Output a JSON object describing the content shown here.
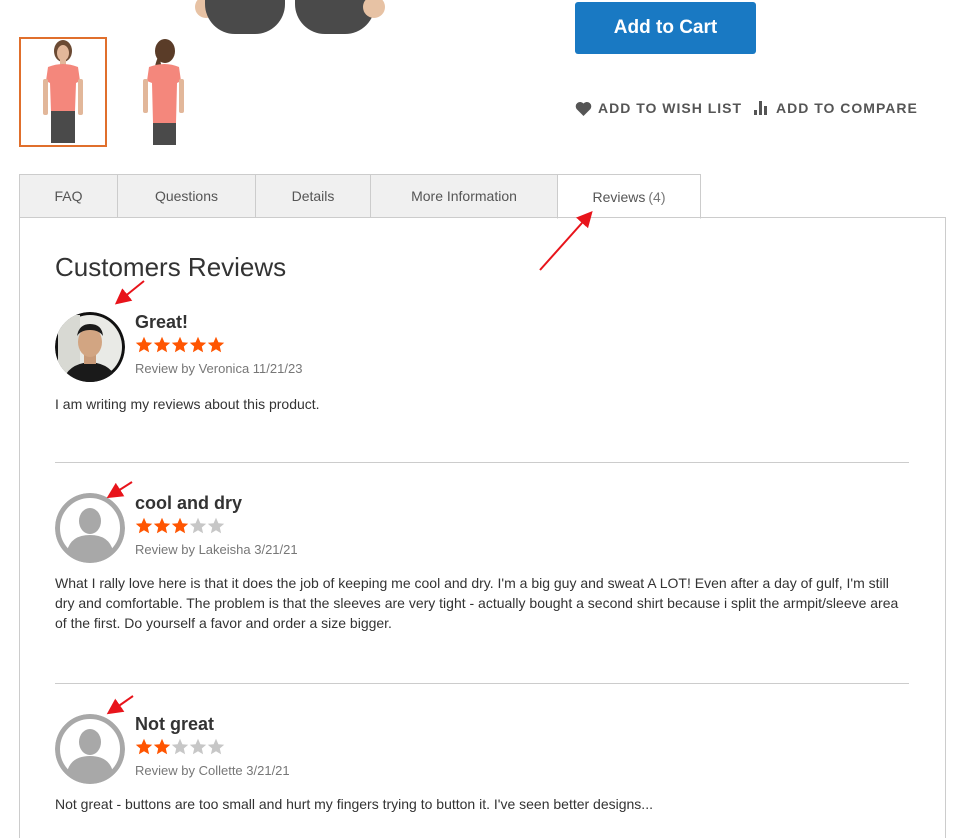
{
  "product": {
    "add_to_cart_label": "Add to Cart",
    "wishlist_label": "ADD TO WISH LIST",
    "compare_label": "ADD TO COMPARE"
  },
  "tabs": [
    {
      "label": "FAQ"
    },
    {
      "label": "Questions"
    },
    {
      "label": "Details"
    },
    {
      "label": "More Information"
    },
    {
      "label": "Reviews",
      "count": "(4)",
      "active": true
    }
  ],
  "reviews_section": {
    "heading": "Customers Reviews",
    "reviews": [
      {
        "title": "Great!",
        "rating": 5,
        "byline": "Review by Veronica 11/21/23",
        "text": "I am writing my reviews about this product.",
        "avatar": "photo"
      },
      {
        "title": "cool and dry",
        "rating": 3,
        "byline": "Review by Lakeisha 3/21/21",
        "text": "What I rally love here is that it does the job of keeping me cool and dry. I'm a big guy and sweat A LOT! Even after a day of gulf, I'm still dry and comfortable. The problem is that the sleeves are very tight - actually bought a second shirt because i split the armpit/sleeve area of the first. Do yourself a favor and order a size bigger.",
        "avatar": "placeholder"
      },
      {
        "title": "Not great",
        "rating": 2,
        "byline": "Review by Collette 3/21/21",
        "text": "Not great - buttons are too small and hurt my fingers trying to button it. I've seen better designs...",
        "avatar": "placeholder"
      }
    ]
  },
  "colors": {
    "accent_blue": "#1979c3",
    "star_filled": "#ff5501",
    "star_empty": "#c7c7c7",
    "thumb_active_border": "#e06f2c",
    "annotation_red": "#e8141b"
  },
  "icons": [
    "heart-icon",
    "compare-icon",
    "star-icon",
    "user-placeholder-icon",
    "annotation-arrow"
  ]
}
